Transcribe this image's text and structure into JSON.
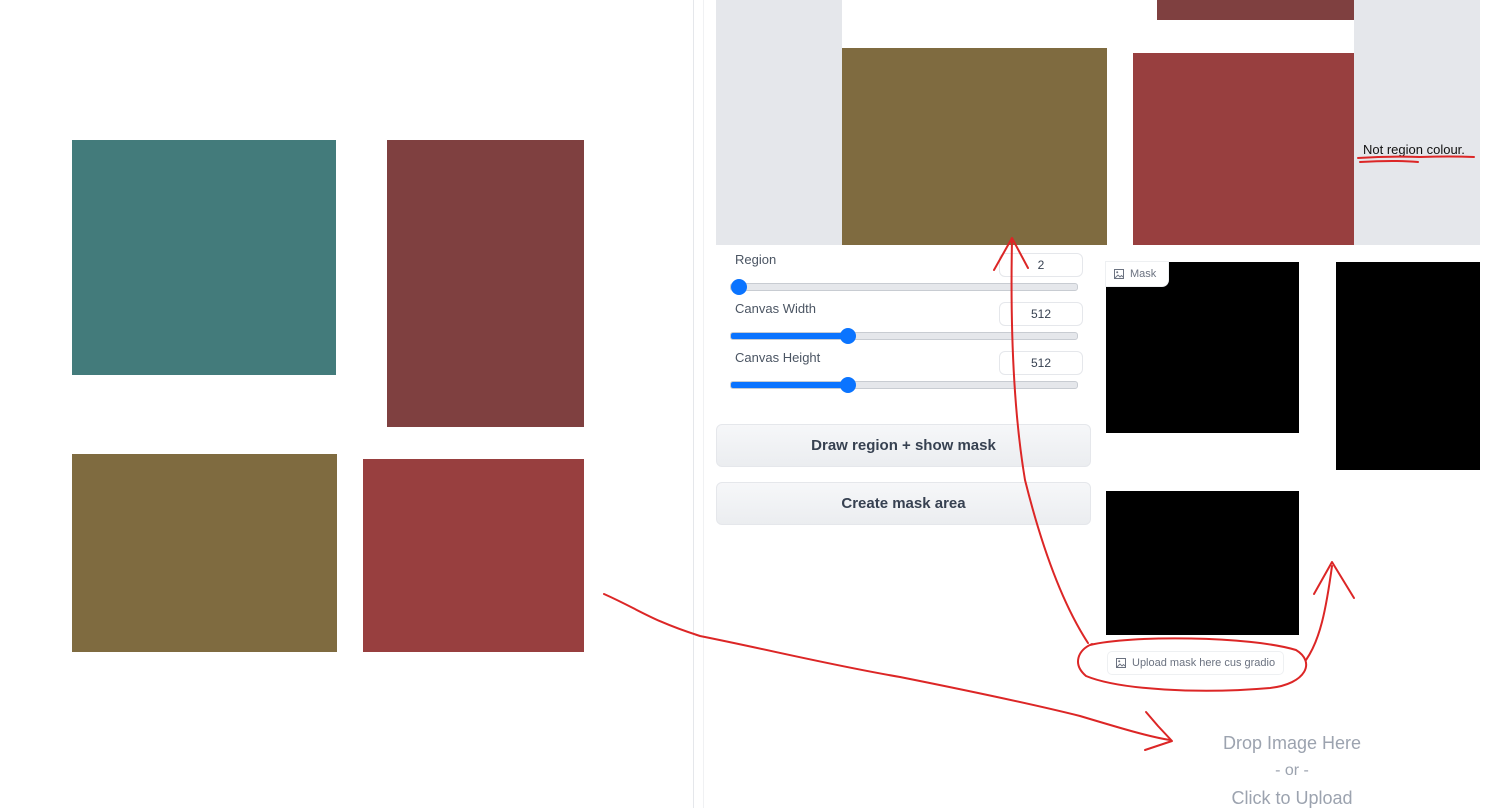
{
  "colors": {
    "teal": "#437b7b",
    "maroon": "#7f4040",
    "olive": "#7f6b40",
    "red": "#983f3f",
    "canvas_gray": "#e5e7eb",
    "black": "#000000",
    "annotation_red": "#dc2626",
    "accent_blue": "#0b74ff"
  },
  "controls": {
    "region": {
      "label": "Region",
      "value": "2",
      "fraction": 0.0
    },
    "canvas_width": {
      "label": "Canvas Width",
      "value": "512",
      "fraction": 0.343
    },
    "canvas_height": {
      "label": "Canvas Height",
      "value": "512",
      "fraction": 0.343
    }
  },
  "buttons": {
    "draw_region": "Draw region + show mask",
    "create_mask": "Create mask area"
  },
  "mask_panel": {
    "label": "Mask",
    "icon": "image-icon"
  },
  "upload": {
    "label": "Upload mask here cus gradio",
    "icon": "image-icon",
    "drop_line1": "Drop Image Here",
    "drop_line2": "- or -",
    "drop_line3": "Click to Upload"
  },
  "annotation": {
    "text": "Not region colour."
  }
}
